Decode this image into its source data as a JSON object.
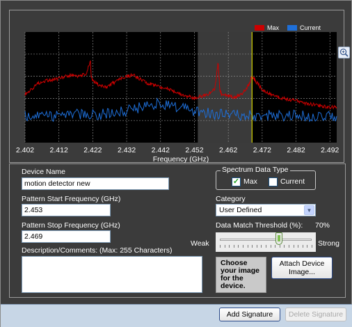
{
  "chart": {
    "legend": [
      {
        "label": "Max",
        "color": "#cc0000"
      },
      {
        "label": "Current",
        "color": "#1e6fd9"
      }
    ],
    "zoom_icon": "magnifier-plus-icon",
    "xlabel": "Frequency (GHz)"
  },
  "chart_data": {
    "type": "line",
    "title": "",
    "xlabel": "Frequency (GHz)",
    "ylabel": "",
    "x_ticks": [
      "2.402",
      "2.412",
      "2.422",
      "2.432",
      "2.442",
      "2.452",
      "2.462",
      "2.472",
      "2.482",
      "2.492"
    ],
    "xlim": [
      2.402,
      2.494
    ],
    "ylim": [
      0,
      100
    ],
    "grid": true,
    "legend_position": "top-right",
    "highlight_band": [
      2.453,
      2.469
    ],
    "marker_line_x": 2.469,
    "series": [
      {
        "name": "Max",
        "color": "#cc0000",
        "x": [
          2.402,
          2.404,
          2.406,
          2.408,
          2.41,
          2.412,
          2.414,
          2.416,
          2.418,
          2.42,
          2.4213,
          2.4215,
          2.4222,
          2.424,
          2.426,
          2.428,
          2.43,
          2.432,
          2.434,
          2.436,
          2.438,
          2.44,
          2.442,
          2.444,
          2.446,
          2.448,
          2.45,
          2.452,
          2.454,
          2.456,
          2.458,
          2.459,
          2.4595,
          2.46,
          2.462,
          2.464,
          2.466,
          2.468,
          2.469,
          2.47,
          2.472,
          2.474,
          2.476,
          2.478,
          2.48,
          2.482,
          2.484,
          2.486,
          2.488,
          2.49,
          2.492,
          2.494
        ],
        "y": [
          44,
          48,
          54,
          56,
          57,
          58,
          60,
          61,
          60,
          62,
          74,
          60,
          55,
          52,
          50,
          54,
          57,
          60,
          61,
          57,
          54,
          52,
          50,
          49,
          46,
          44,
          42,
          40,
          42,
          44,
          48,
          72,
          48,
          44,
          42,
          41,
          44,
          52,
          60,
          56,
          48,
          44,
          42,
          40,
          39,
          38,
          36,
          35,
          34,
          33,
          32,
          32
        ]
      },
      {
        "name": "Current",
        "color": "#1e6fd9",
        "x": [
          2.402,
          2.406,
          2.41,
          2.414,
          2.418,
          2.422,
          2.426,
          2.43,
          2.434,
          2.438,
          2.442,
          2.446,
          2.45,
          2.454,
          2.458,
          2.462,
          2.466,
          2.47,
          2.474,
          2.478,
          2.482,
          2.486,
          2.49,
          2.494
        ],
        "y": [
          24,
          25,
          24,
          25,
          26,
          25,
          26,
          28,
          30,
          34,
          36,
          33,
          30,
          27,
          26,
          25,
          25,
          24,
          25,
          24,
          25,
          24,
          25,
          24
        ]
      }
    ]
  },
  "device": {
    "name_label": "Device Name",
    "name_value": "motion detector new",
    "start_label": "Pattern Start Frequency (GHz)",
    "start_value": "2.453",
    "stop_label": "Pattern Stop Frequency (GHz)",
    "stop_value": "2.469",
    "desc_label": "Description/Comments: (Max: 255 Characters)",
    "desc_value": ""
  },
  "spectrum_type": {
    "legend": "Spectrum Data Type",
    "max_label": "Max",
    "max_checked": true,
    "current_label": "Current",
    "current_checked": false
  },
  "category": {
    "label": "Category",
    "value": "User Defined"
  },
  "threshold": {
    "label": "Data Match Threshold (%):",
    "value_text": "70%",
    "value": 70,
    "weak_label": "Weak",
    "strong_label": "Strong"
  },
  "image": {
    "placeholder_text": "Choose your image for the device.",
    "attach_button": "Attach Device Image..."
  },
  "footer": {
    "add_button": "Add Signature",
    "delete_button": "Delete Signature"
  }
}
